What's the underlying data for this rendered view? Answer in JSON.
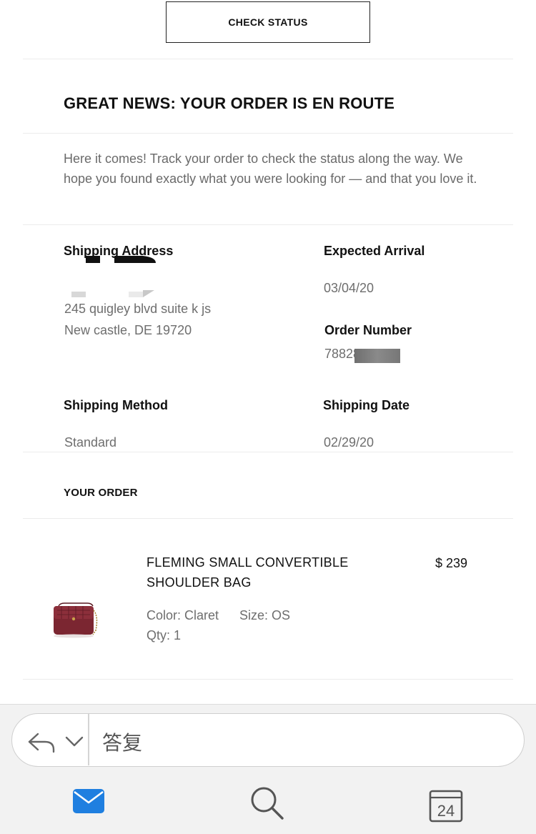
{
  "email": {
    "check_status_button": "CHECK STATUS",
    "headline": "GREAT NEWS: YOUR ORDER IS EN ROUTE",
    "intro": "Here it comes! Track your order to check the status along the way. We hope you found exactly what you were looking for — and that you love it.",
    "shipping_address": {
      "label": "Shipping Address",
      "line1": "245 quigley blvd suite k js",
      "line2": "New castle, DE 19720"
    },
    "expected_arrival": {
      "label": "Expected Arrival",
      "value": "03/04/20"
    },
    "order_number": {
      "label": "Order Number",
      "value": "78828"
    },
    "shipping_method": {
      "label": "Shipping Method",
      "value": "Standard"
    },
    "shipping_date": {
      "label": "Shipping Date",
      "value": "02/29/20"
    },
    "your_order_heading": "YOUR ORDER",
    "item": {
      "name_line1": "FLEMING SMALL CONVERTIBLE",
      "name_line2": "SHOULDER BAG",
      "price": "$ 239",
      "color": "Color: Claret",
      "size": "Size: OS",
      "qty": "Qty: 1",
      "image_color": "#7b2631"
    }
  },
  "reply_bar": {
    "back_icon": "reply-arrow-icon",
    "expand_icon": "chevron-down-icon",
    "reply_label": "答复"
  },
  "tab_bar": {
    "items": [
      {
        "icon": "mail-icon",
        "color": "#1f7fe0"
      },
      {
        "icon": "search-icon",
        "color": "#555555"
      },
      {
        "icon": "calendar-icon",
        "date": "24",
        "color": "#555555"
      }
    ]
  }
}
